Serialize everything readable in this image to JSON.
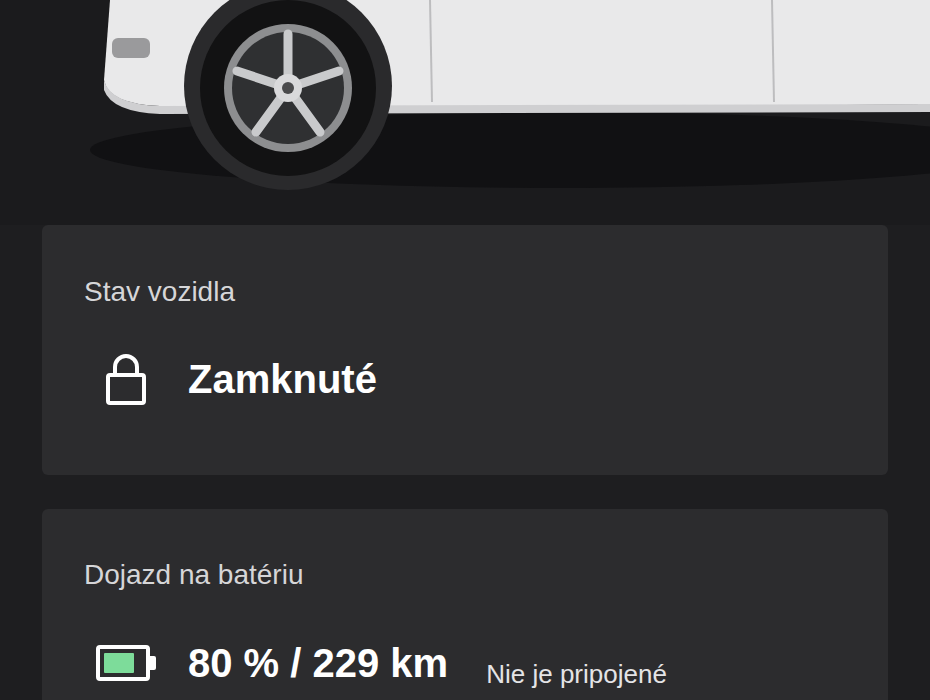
{
  "vehicle_status": {
    "label": "Stav vozidla",
    "value": "Zamknuté",
    "locked": true
  },
  "battery": {
    "label": "Dojazd na batériu",
    "value": "80 % / 229 km",
    "level": 0.8,
    "connection": "Nie je pripojené"
  }
}
